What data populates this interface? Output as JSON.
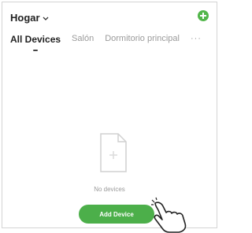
{
  "header": {
    "home_label": "Hogar",
    "home_chevron_icon": "chevron-down-icon",
    "add_icon": "plus-circle-icon",
    "add_icon_color": "#52b64a"
  },
  "tabs": [
    {
      "label": "All Devices",
      "active": true
    },
    {
      "label": "Salón",
      "active": false
    },
    {
      "label": "Dormitorio principal",
      "active": false
    }
  ],
  "tabs_more_label": "···",
  "empty_state": {
    "icon": "blank-document-icon",
    "text": "No devices"
  },
  "add_device_button": {
    "label": "Add Device",
    "color": "#4caf4a"
  },
  "pointer_icon": "pointing-hand-icon"
}
